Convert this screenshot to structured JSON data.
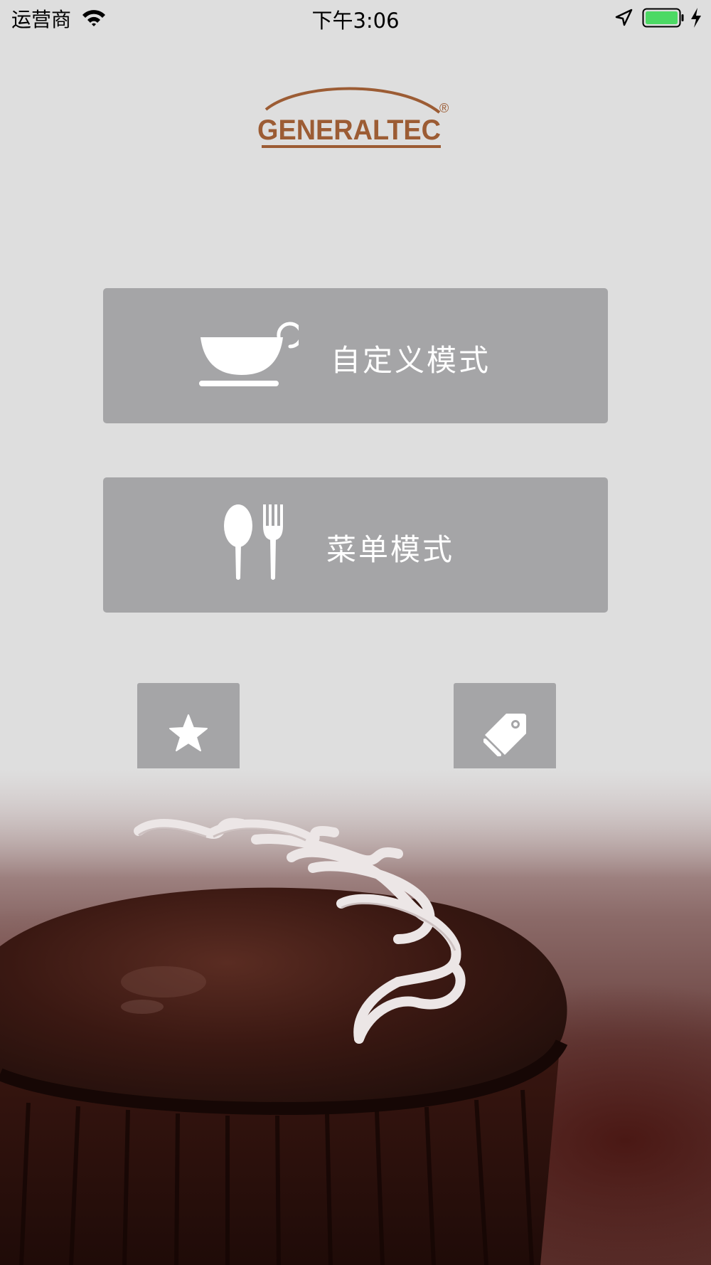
{
  "status_bar": {
    "carrier": "运营商",
    "time": "下午3:06",
    "icons": [
      "wifi-icon",
      "location-arrow-icon",
      "battery-icon",
      "charging-bolt-icon"
    ],
    "battery_color": "#4cd964"
  },
  "logo": {
    "text": "GENERALTEC",
    "registered": "®",
    "color": "#9c5c34"
  },
  "buttons": {
    "custom_mode": {
      "label": "自定义模式",
      "icon": "coffee-cup-icon"
    },
    "menu_mode": {
      "label": "菜单模式",
      "icon": "spoon-fork-icon"
    },
    "favorites": {
      "icon": "star-icon"
    },
    "tag": {
      "icon": "tag-icon"
    }
  },
  "colors": {
    "background": "#dedede",
    "button": "#a5a5a7",
    "button_text": "#ffffff"
  },
  "hero_image": {
    "subject": "chocolate-cupcake-image"
  }
}
